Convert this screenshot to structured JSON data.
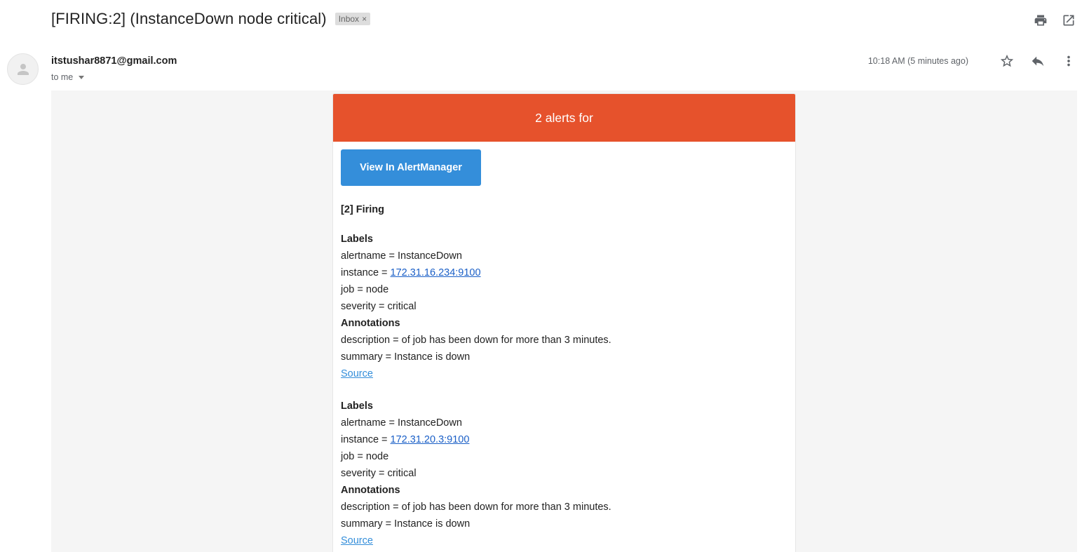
{
  "email": {
    "subject": "[FIRING:2] (InstanceDown node critical)",
    "label_chip": "Inbox",
    "label_chip_close": "×",
    "sender": "itstushar8871@gmail.com",
    "recipient": "to me",
    "timestamp": "10:18 AM (5 minutes ago)"
  },
  "icons": {
    "top": [
      "print-icon",
      "open-in-new-window-icon"
    ],
    "meta": [
      "star-icon",
      "reply-icon",
      "more-options-icon"
    ],
    "avatar": "person-icon"
  },
  "alert_email": {
    "banner": "2 alerts for",
    "button_label": "View In AlertManager",
    "firing_heading": "[2] Firing",
    "alerts": [
      {
        "labels_heading": "Labels",
        "alertname": "alertname = InstanceDown",
        "instance_prefix": "instance = ",
        "instance_link": "172.31.16.234:9100",
        "job": "job = node",
        "severity": "severity = critical",
        "annotations_heading": "Annotations",
        "description": "description = of job has been down for more than 3 minutes.",
        "summary": "summary = Instance is down",
        "source_link": "Source"
      },
      {
        "labels_heading": "Labels",
        "alertname": "alertname = InstanceDown",
        "instance_prefix": "instance = ",
        "instance_link": "172.31.20.3:9100",
        "job": "job = node",
        "severity": "severity = critical",
        "annotations_heading": "Annotations",
        "description": "description = of job has been down for more than 3 minutes.",
        "summary": "summary = Instance is down",
        "source_link": "Source"
      }
    ]
  },
  "colors": {
    "banner": "#e6522c",
    "button": "#348eda",
    "link": "#1a5fc7",
    "body_background": "#f5f5f5"
  }
}
